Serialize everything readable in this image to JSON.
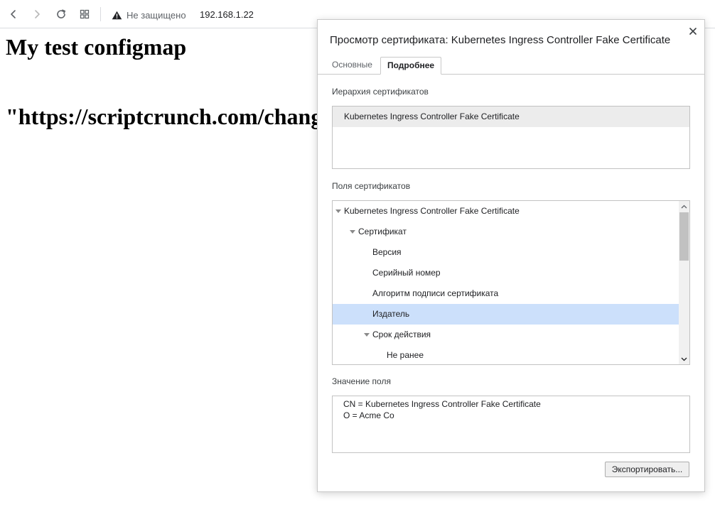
{
  "toolbar": {
    "security_label": "Не защищено",
    "url": "192.168.1.22"
  },
  "page": {
    "heading": "My test configmap",
    "subheading": "\"https://scriptcrunch.com/chang"
  },
  "dialog": {
    "title": "Просмотр сертификата: Kubernetes Ingress Controller Fake Certificate",
    "tabs": [
      {
        "label": "Основные",
        "active": false
      },
      {
        "label": "Подробнее",
        "active": true
      }
    ],
    "hierarchy": {
      "label": "Иерархия сертификатов",
      "items": [
        "Kubernetes Ingress Controller Fake Certificate"
      ]
    },
    "fields": {
      "label": "Поля сертификатов",
      "items": [
        {
          "text": "Kubernetes Ingress Controller Fake Certificate",
          "expanded": true,
          "selected": false
        },
        {
          "text": "Сертификат",
          "expanded": true,
          "selected": false
        },
        {
          "text": "Версия",
          "expanded": false,
          "selected": false
        },
        {
          "text": "Серийный номер",
          "expanded": false,
          "selected": false
        },
        {
          "text": "Алгоритм подписи сертификата",
          "expanded": false,
          "selected": false
        },
        {
          "text": "Издатель",
          "expanded": false,
          "selected": true
        },
        {
          "text": "Срок действия",
          "expanded": true,
          "selected": false
        },
        {
          "text": "Не ранее",
          "expanded": false,
          "selected": false
        }
      ]
    },
    "field_value": {
      "label": "Значение поля",
      "lines": [
        "CN = Kubernetes Ingress Controller Fake Certificate",
        "O = Acme Co"
      ]
    },
    "export_label": "Экспортировать..."
  }
}
